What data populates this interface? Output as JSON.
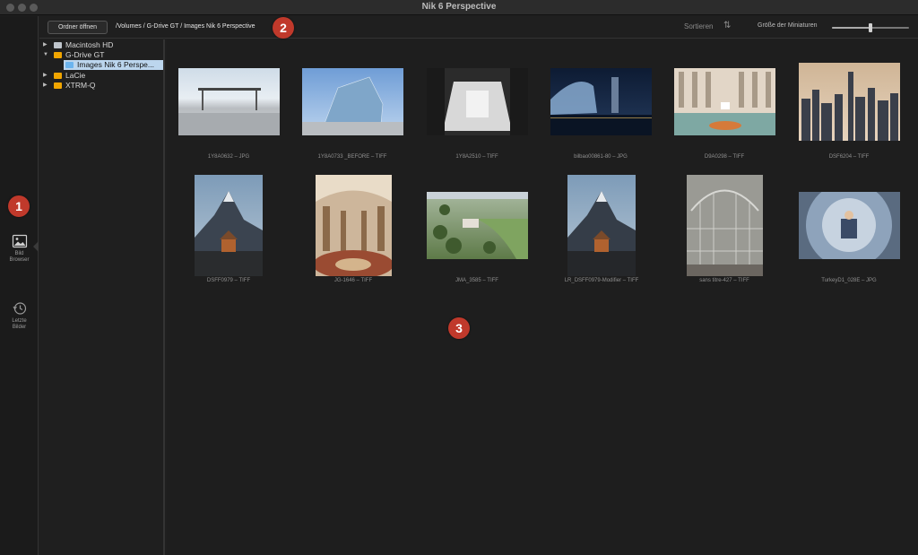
{
  "window": {
    "title": "Nik 6 Perspective"
  },
  "leftnav": {
    "items": [
      {
        "label_line1": "Bild",
        "label_line2": "Browser",
        "icon": "image-browser-icon"
      },
      {
        "label_line1": "Letzte",
        "label_line2": "Bilder",
        "icon": "history-clock-icon"
      }
    ]
  },
  "toolbar": {
    "open_folder_label": "Ordner öffnen",
    "path": "/Volumes / G-Drive GT / Images Nik 6 Perspective",
    "sort_label": "Sortieren",
    "sort_icon": "sort-arrows-icon",
    "thumb_size_label": "Größe der Miniaturen",
    "thumb_size_level": 0.5
  },
  "tree": [
    {
      "label": "Macintosh HD",
      "expanded": false,
      "color": "#bfc5cc"
    },
    {
      "label": "G-Drive GT",
      "expanded": true,
      "color": "#f0a500"
    },
    {
      "label": "Images Nik 6 Perspe...",
      "selected": true,
      "color": "#6cb4ee"
    },
    {
      "label": "LaCie",
      "expanded": false,
      "color": "#f0a500"
    },
    {
      "label": "XTRM-Q",
      "expanded": false,
      "color": "#f0a500"
    }
  ],
  "images": [
    {
      "caption": "1Y8A0632 – JPG"
    },
    {
      "caption": "1Y8A0733 _BEFORE – TIFF"
    },
    {
      "caption": "1Y8A2510 – TIFF"
    },
    {
      "caption": "bilbao00861-80 – JPG"
    },
    {
      "caption": "D9A0298 – TIFF"
    },
    {
      "caption": "DSF6204 – TIFF"
    },
    {
      "caption": "DSFF0979 – TIFF"
    },
    {
      "caption": "JG-1646 – TIFF"
    },
    {
      "caption": "JMA_3585 – TIFF"
    },
    {
      "caption": "LR_DSFF0979-Modifier – TIFF"
    },
    {
      "caption": "sans titre-427 – TIFF"
    },
    {
      "caption": "TurkeyD1_028E – JPG"
    }
  ],
  "badges": [
    "1",
    "2",
    "3"
  ]
}
